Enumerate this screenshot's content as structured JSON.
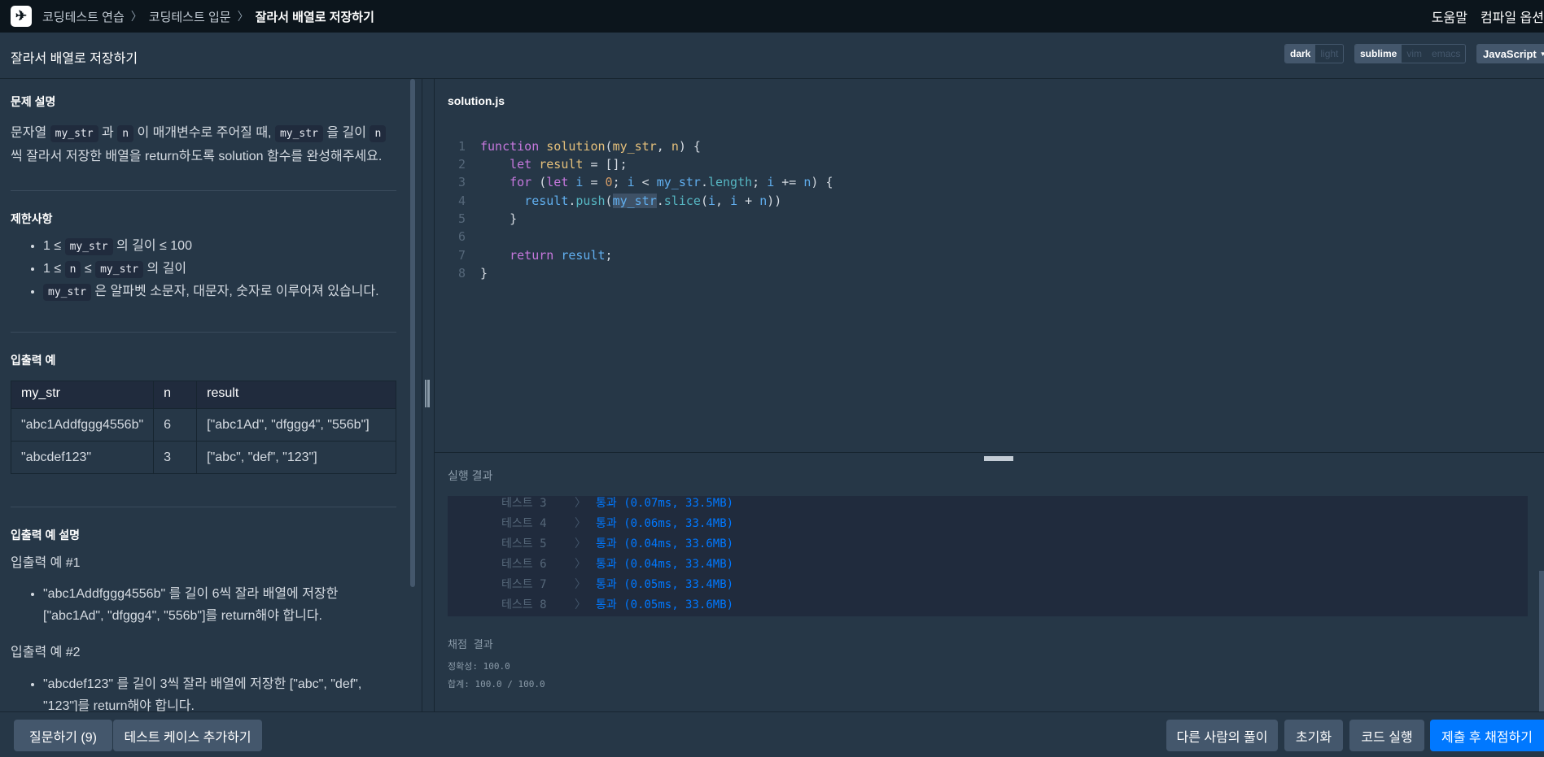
{
  "nav": {
    "breadcrumbs": [
      "코딩테스트 연습",
      "코딩테스트 입문",
      "잘라서 배열로 저장하기"
    ],
    "help_label": "도움말",
    "compile_options_label": "컴파일 옵션"
  },
  "header": {
    "title": "잘라서 배열로 저장하기",
    "theme_options": [
      "dark",
      "light"
    ],
    "theme_selected": "dark",
    "keymap_options": [
      "sublime",
      "vim",
      "emacs"
    ],
    "keymap_selected": "sublime",
    "language": "JavaScript"
  },
  "problem": {
    "description_title": "문제 설명",
    "desc_part1": "문자열",
    "desc_code1": "my_str",
    "desc_part2": "과",
    "desc_code2": "n",
    "desc_part3": "이 매개변수로 주어질 때,",
    "desc_code3": "my_str",
    "desc_part4": "을 길이",
    "desc_code4": "n",
    "desc_part5": "씩 잘라서 저장한 배열을 return하도록 solution 함수를 완성해주세요.",
    "constraints_title": "제한사항",
    "c1_prefix": "1 ≤",
    "c1_code": "my_str",
    "c1_suffix": "의 길이 ≤ 100",
    "c2_prefix": "1 ≤",
    "c2_code1": "n",
    "c2_mid": "≤",
    "c2_code2": "my_str",
    "c2_suffix": "의 길이",
    "c3_code": "my_str",
    "c3_suffix": "은 알파벳 소문자, 대문자, 숫자로 이루어져 있습니다.",
    "examples_title": "입출력 예",
    "table_headers": [
      "my_str",
      "n",
      "result"
    ],
    "table_rows": [
      [
        "\"abc1Addfggg4556b\"",
        "6",
        "[\"abc1Ad\", \"dfggg4\", \"556b\"]"
      ],
      [
        "\"abcdef123\"",
        "3",
        "[\"abc\", \"def\", \"123\"]"
      ]
    ],
    "explain_title": "입출력 예 설명",
    "ex1_title": "입출력 예 #1",
    "ex1_text": "\"abc1Addfggg4556b\" 를 길이 6씩 잘라 배열에 저장한 [\"abc1Ad\", \"dfggg4\", \"556b\"]를 return해야 합니다.",
    "ex2_title": "입출력 예 #2",
    "ex2_text": "\"abcdef123\" 를 길이 3씩 잘라 배열에 저장한 [\"abc\", \"def\", \"123\"]를 return해야 합니다."
  },
  "editor": {
    "filename": "solution.js",
    "line_numbers": [
      "1",
      "2",
      "3",
      "4",
      "5",
      "6",
      "7",
      "8"
    ]
  },
  "results": {
    "title": "실행 결과",
    "tests": [
      {
        "label": "테스트 3",
        "result": "통과 (0.07ms, 33.5MB)"
      },
      {
        "label": "테스트 4",
        "result": "통과 (0.06ms, 33.4MB)"
      },
      {
        "label": "테스트 5",
        "result": "통과 (0.04ms, 33.6MB)"
      },
      {
        "label": "테스트 6",
        "result": "통과 (0.04ms, 33.4MB)"
      },
      {
        "label": "테스트 7",
        "result": "통과 (0.05ms, 33.4MB)"
      },
      {
        "label": "테스트 8",
        "result": "통과 (0.05ms, 33.6MB)"
      }
    ],
    "grading_title": "채점 결과",
    "accuracy": "정확성: 100.0",
    "total": "합계: 100.0 / 100.0"
  },
  "footer": {
    "question_button": "질문하기 (9)",
    "add_testcase_button": "테스트 케이스 추가하기",
    "others_solution_button": "다른 사람의 풀이",
    "reset_button": "초기화",
    "run_button": "코드 실행",
    "submit_button": "제출 후 채점하기"
  },
  "colors": {
    "primary": "#0078ff",
    "background": "#263747",
    "topbar": "#0c151c"
  }
}
